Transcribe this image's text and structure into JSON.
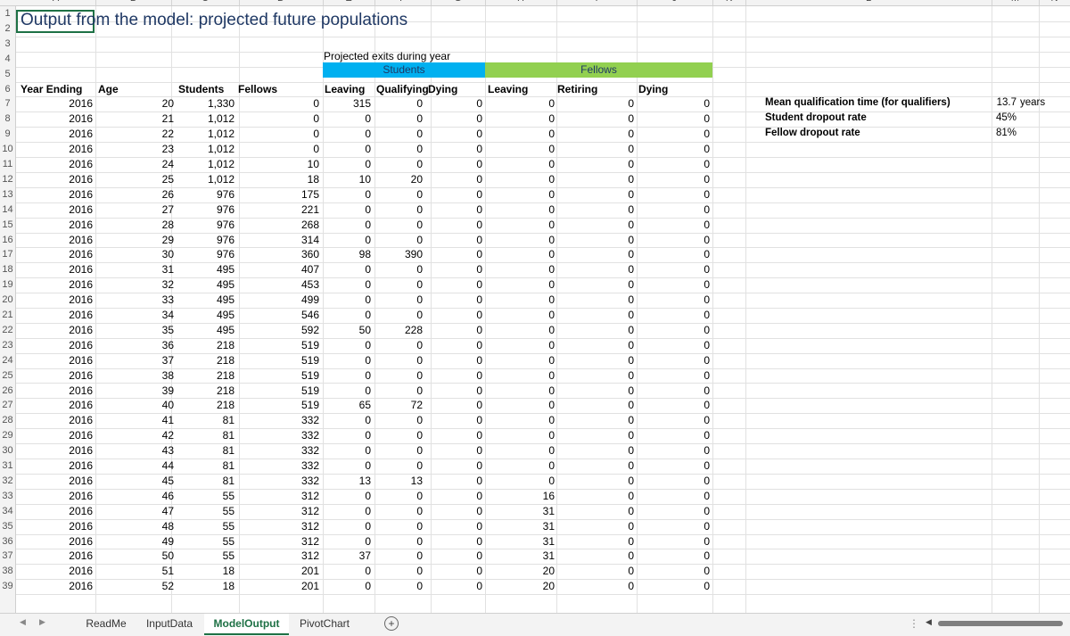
{
  "sheet": {
    "title": "Output from the model: projected future populations",
    "column_letters": [
      "A",
      "B",
      "C",
      "D",
      "E",
      "F",
      "G",
      "H",
      "I",
      "J",
      "K",
      "L",
      "M",
      "N"
    ],
    "row_numbers": [
      "1",
      "2",
      "3",
      "4",
      "5",
      "6",
      "7",
      "8",
      "9",
      "10",
      "11",
      "12",
      "13",
      "14",
      "15",
      "16",
      "17",
      "18",
      "19",
      "20",
      "21",
      "22",
      "23",
      "24",
      "25",
      "26",
      "27",
      "28",
      "29",
      "30",
      "31",
      "32",
      "33",
      "34",
      "35",
      "36",
      "37",
      "38",
      "39"
    ],
    "projected_exits_label": "Projected exits during year",
    "group_students": "Students",
    "group_fellows": "Fellows",
    "headers": [
      "Year Ending",
      "Age",
      "Students",
      "Fellows",
      "Leaving",
      "Qualifying",
      "Dying",
      "Leaving",
      "Retiring",
      "Dying"
    ],
    "rows": [
      [
        "2016",
        "20",
        "1,330",
        "0",
        "315",
        "0",
        "0",
        "0",
        "0",
        "0"
      ],
      [
        "2016",
        "21",
        "1,012",
        "0",
        "0",
        "0",
        "0",
        "0",
        "0",
        "0"
      ],
      [
        "2016",
        "22",
        "1,012",
        "0",
        "0",
        "0",
        "0",
        "0",
        "0",
        "0"
      ],
      [
        "2016",
        "23",
        "1,012",
        "0",
        "0",
        "0",
        "0",
        "0",
        "0",
        "0"
      ],
      [
        "2016",
        "24",
        "1,012",
        "10",
        "0",
        "0",
        "0",
        "0",
        "0",
        "0"
      ],
      [
        "2016",
        "25",
        "1,012",
        "18",
        "10",
        "20",
        "0",
        "0",
        "0",
        "0"
      ],
      [
        "2016",
        "26",
        "976",
        "175",
        "0",
        "0",
        "0",
        "0",
        "0",
        "0"
      ],
      [
        "2016",
        "27",
        "976",
        "221",
        "0",
        "0",
        "0",
        "0",
        "0",
        "0"
      ],
      [
        "2016",
        "28",
        "976",
        "268",
        "0",
        "0",
        "0",
        "0",
        "0",
        "0"
      ],
      [
        "2016",
        "29",
        "976",
        "314",
        "0",
        "0",
        "0",
        "0",
        "0",
        "0"
      ],
      [
        "2016",
        "30",
        "976",
        "360",
        "98",
        "390",
        "0",
        "0",
        "0",
        "0"
      ],
      [
        "2016",
        "31",
        "495",
        "407",
        "0",
        "0",
        "0",
        "0",
        "0",
        "0"
      ],
      [
        "2016",
        "32",
        "495",
        "453",
        "0",
        "0",
        "0",
        "0",
        "0",
        "0"
      ],
      [
        "2016",
        "33",
        "495",
        "499",
        "0",
        "0",
        "0",
        "0",
        "0",
        "0"
      ],
      [
        "2016",
        "34",
        "495",
        "546",
        "0",
        "0",
        "0",
        "0",
        "0",
        "0"
      ],
      [
        "2016",
        "35",
        "495",
        "592",
        "50",
        "228",
        "0",
        "0",
        "0",
        "0"
      ],
      [
        "2016",
        "36",
        "218",
        "519",
        "0",
        "0",
        "0",
        "0",
        "0",
        "0"
      ],
      [
        "2016",
        "37",
        "218",
        "519",
        "0",
        "0",
        "0",
        "0",
        "0",
        "0"
      ],
      [
        "2016",
        "38",
        "218",
        "519",
        "0",
        "0",
        "0",
        "0",
        "0",
        "0"
      ],
      [
        "2016",
        "39",
        "218",
        "519",
        "0",
        "0",
        "0",
        "0",
        "0",
        "0"
      ],
      [
        "2016",
        "40",
        "218",
        "519",
        "65",
        "72",
        "0",
        "0",
        "0",
        "0"
      ],
      [
        "2016",
        "41",
        "81",
        "332",
        "0",
        "0",
        "0",
        "0",
        "0",
        "0"
      ],
      [
        "2016",
        "42",
        "81",
        "332",
        "0",
        "0",
        "0",
        "0",
        "0",
        "0"
      ],
      [
        "2016",
        "43",
        "81",
        "332",
        "0",
        "0",
        "0",
        "0",
        "0",
        "0"
      ],
      [
        "2016",
        "44",
        "81",
        "332",
        "0",
        "0",
        "0",
        "0",
        "0",
        "0"
      ],
      [
        "2016",
        "45",
        "81",
        "332",
        "13",
        "13",
        "0",
        "0",
        "0",
        "0"
      ],
      [
        "2016",
        "46",
        "55",
        "312",
        "0",
        "0",
        "0",
        "16",
        "0",
        "0"
      ],
      [
        "2016",
        "47",
        "55",
        "312",
        "0",
        "0",
        "0",
        "31",
        "0",
        "0"
      ],
      [
        "2016",
        "48",
        "55",
        "312",
        "0",
        "0",
        "0",
        "31",
        "0",
        "0"
      ],
      [
        "2016",
        "49",
        "55",
        "312",
        "0",
        "0",
        "0",
        "31",
        "0",
        "0"
      ],
      [
        "2016",
        "50",
        "55",
        "312",
        "37",
        "0",
        "0",
        "31",
        "0",
        "0"
      ],
      [
        "2016",
        "51",
        "18",
        "201",
        "0",
        "0",
        "0",
        "20",
        "0",
        "0"
      ],
      [
        "2016",
        "52",
        "18",
        "201",
        "0",
        "0",
        "0",
        "20",
        "0",
        "0"
      ]
    ],
    "summary": [
      {
        "label": "Mean qualification time (for qualifiers)",
        "value": "13.7",
        "unit": "years"
      },
      {
        "label": "Student dropout rate",
        "value": "45%",
        "unit": ""
      },
      {
        "label": "Fellow dropout rate",
        "value": "81%",
        "unit": ""
      }
    ]
  },
  "tabs": {
    "items": [
      "ReadMe",
      "InputData",
      "ModelOutput",
      "PivotChart"
    ],
    "active": "ModelOutput",
    "add_symbol": "+",
    "nav_prev": "◀",
    "nav_next": "▶",
    "more_symbol": "⋮"
  },
  "colors": {
    "students_band": "#00b0f0",
    "fellows_band": "#92d050",
    "active_tab": "#1e7145"
  }
}
